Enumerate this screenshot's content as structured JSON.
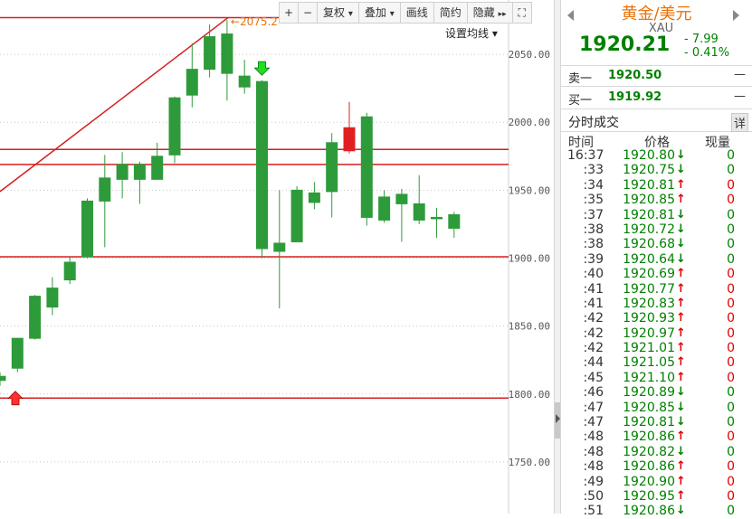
{
  "toolbar": {
    "plus": "+",
    "minus": "−",
    "fuquan": "复权",
    "diejia": "叠加",
    "huaxian": "画线",
    "jianyue": "简约",
    "yincang": "隐藏",
    "dropdown_glyph": "▾",
    "hide_glyph": "▸▸",
    "expand_glyph": "⛶"
  },
  "ma_setting": "设置均线 ▾",
  "colors": {
    "up": "#e02020",
    "down": "#2e9b3a",
    "line": "#d61f1f",
    "price_text": "#008000"
  },
  "chart_data": {
    "type": "candlestick",
    "ylim": [
      1712,
      2090
    ],
    "y_ticks": [
      2050,
      2000,
      1950,
      1900,
      1850,
      1800,
      1750
    ],
    "y_tick_labels": [
      "2050.00",
      "2000.00",
      "1950.00",
      "1900.00",
      "1850.00",
      "1800.00",
      "1750.00"
    ],
    "candles": [
      {
        "o": 1813,
        "c": 1810,
        "h": 1816,
        "l": 1806,
        "dir": "down"
      },
      {
        "o": 1819,
        "c": 1841,
        "h": 1841,
        "l": 1816,
        "dir": "up",
        "fill": "green"
      },
      {
        "o": 1841,
        "c": 1872,
        "h": 1873,
        "l": 1840,
        "dir": "up",
        "fill": "green"
      },
      {
        "o": 1864,
        "c": 1878,
        "h": 1886,
        "l": 1858,
        "dir": "up",
        "fill": "green"
      },
      {
        "o": 1884,
        "c": 1897,
        "h": 1901,
        "l": 1881,
        "dir": "up",
        "fill": "green"
      },
      {
        "o": 1901,
        "c": 1942,
        "h": 1944,
        "l": 1900,
        "dir": "up",
        "fill": "green"
      },
      {
        "o": 1942,
        "c": 1959,
        "h": 1976,
        "l": 1908,
        "dir": "up",
        "fill": "green"
      },
      {
        "o": 1958,
        "c": 1969,
        "h": 1978,
        "l": 1944,
        "dir": "up",
        "fill": "green"
      },
      {
        "o": 1958,
        "c": 1969,
        "h": 1971,
        "l": 1940,
        "dir": "up",
        "fill": "green"
      },
      {
        "o": 1958,
        "c": 1975,
        "h": 1985,
        "l": 1958,
        "dir": "up",
        "fill": "green"
      },
      {
        "o": 1976,
        "c": 2018,
        "h": 2019,
        "l": 1970,
        "dir": "up",
        "fill": "green"
      },
      {
        "o": 2020,
        "c": 2039,
        "h": 2058,
        "l": 2011,
        "dir": "up",
        "fill": "green"
      },
      {
        "o": 2039,
        "c": 2063,
        "h": 2072,
        "l": 2033,
        "dir": "up",
        "fill": "green"
      },
      {
        "o": 2036,
        "c": 2065,
        "h": 2075.2,
        "l": 2016,
        "dir": "up",
        "fill": "green"
      },
      {
        "o": 2034,
        "c": 2026,
        "h": 2046,
        "l": 2021,
        "dir": "down"
      },
      {
        "o": 2030,
        "c": 1907,
        "h": 2031,
        "l": 1900,
        "dir": "down"
      },
      {
        "o": 1911,
        "c": 1905,
        "h": 1950,
        "l": 1863,
        "dir": "down"
      },
      {
        "o": 1912,
        "c": 1950,
        "h": 1953,
        "l": 1912,
        "dir": "up",
        "fill": "green"
      },
      {
        "o": 1941,
        "c": 1948,
        "h": 1956,
        "l": 1936,
        "dir": "up",
        "fill": "green"
      },
      {
        "o": 1949,
        "c": 1985,
        "h": 1992,
        "l": 1930,
        "dir": "up",
        "fill": "green"
      },
      {
        "o": 1979,
        "c": 1996,
        "h": 2015,
        "l": 1977,
        "dir": "up",
        "fill": "red"
      },
      {
        "o": 2004,
        "c": 1930,
        "h": 2007,
        "l": 1924,
        "dir": "down"
      },
      {
        "o": 1945,
        "c": 1928,
        "h": 1950,
        "l": 1926,
        "dir": "down"
      },
      {
        "o": 1947,
        "c": 1940,
        "h": 1951,
        "l": 1912,
        "dir": "down"
      },
      {
        "o": 1940,
        "c": 1928,
        "h": 1961,
        "l": 1925,
        "dir": "down"
      },
      {
        "o": 1930,
        "c": 1929,
        "h": 1937,
        "l": 1915,
        "dir": "down"
      },
      {
        "o": 1932,
        "c": 1922,
        "h": 1934,
        "l": 1915,
        "dir": "down"
      }
    ],
    "horizontal_lines": [
      2077,
      1980,
      1969,
      1901,
      1797
    ],
    "trend_line": {
      "from_price": 1949,
      "to_index": 13,
      "to_price": 2077
    },
    "annotations": [
      {
        "label": "←2075.2",
        "index": 13,
        "price": 2075.2
      },
      {
        "label": "buy-arrow",
        "index": 0,
        "price": 1806
      },
      {
        "label": "sell-arrow",
        "index": 15,
        "price": 2034
      }
    ]
  },
  "quote": {
    "name": "黄金/美元",
    "code": "XAU",
    "price": "1920.21",
    "change": "- 7.99",
    "change_pct": "- 0.41%",
    "sell_label": "卖一",
    "sell_price": "1920.50",
    "buy_label": "买一",
    "buy_price": "1919.92",
    "dash": "—",
    "tick_title": "分时成交",
    "detail_btn": "详",
    "col_time": "时间",
    "col_price": "价格",
    "col_volume": "现量"
  },
  "trades": [
    {
      "time": "16:37",
      "price": "1920.80",
      "dir": "down",
      "vol": "0"
    },
    {
      "time": ":33",
      "price": "1920.75",
      "dir": "down",
      "vol": "0"
    },
    {
      "time": ":34",
      "price": "1920.81",
      "dir": "up",
      "vol": "0"
    },
    {
      "time": ":35",
      "price": "1920.85",
      "dir": "up",
      "vol": "0"
    },
    {
      "time": ":37",
      "price": "1920.81",
      "dir": "down",
      "vol": "0"
    },
    {
      "time": ":38",
      "price": "1920.72",
      "dir": "down",
      "vol": "0"
    },
    {
      "time": ":38",
      "price": "1920.68",
      "dir": "down",
      "vol": "0"
    },
    {
      "time": ":39",
      "price": "1920.64",
      "dir": "down",
      "vol": "0"
    },
    {
      "time": ":40",
      "price": "1920.69",
      "dir": "up",
      "vol": "0"
    },
    {
      "time": ":41",
      "price": "1920.77",
      "dir": "up",
      "vol": "0"
    },
    {
      "time": ":41",
      "price": "1920.83",
      "dir": "up",
      "vol": "0"
    },
    {
      "time": ":42",
      "price": "1920.93",
      "dir": "up",
      "vol": "0"
    },
    {
      "time": ":42",
      "price": "1920.97",
      "dir": "up",
      "vol": "0"
    },
    {
      "time": ":42",
      "price": "1921.01",
      "dir": "up",
      "vol": "0"
    },
    {
      "time": ":44",
      "price": "1921.05",
      "dir": "up",
      "vol": "0"
    },
    {
      "time": ":45",
      "price": "1921.10",
      "dir": "up",
      "vol": "0"
    },
    {
      "time": ":46",
      "price": "1920.89",
      "dir": "down",
      "vol": "0"
    },
    {
      "time": ":47",
      "price": "1920.85",
      "dir": "down",
      "vol": "0"
    },
    {
      "time": ":47",
      "price": "1920.81",
      "dir": "down",
      "vol": "0"
    },
    {
      "time": ":48",
      "price": "1920.86",
      "dir": "up",
      "vol": "0"
    },
    {
      "time": ":48",
      "price": "1920.82",
      "dir": "down",
      "vol": "0"
    },
    {
      "time": ":48",
      "price": "1920.86",
      "dir": "up",
      "vol": "0"
    },
    {
      "time": ":49",
      "price": "1920.90",
      "dir": "up",
      "vol": "0"
    },
    {
      "time": ":50",
      "price": "1920.95",
      "dir": "up",
      "vol": "0"
    },
    {
      "time": ":51",
      "price": "1920.86",
      "dir": "down",
      "vol": "0"
    }
  ]
}
